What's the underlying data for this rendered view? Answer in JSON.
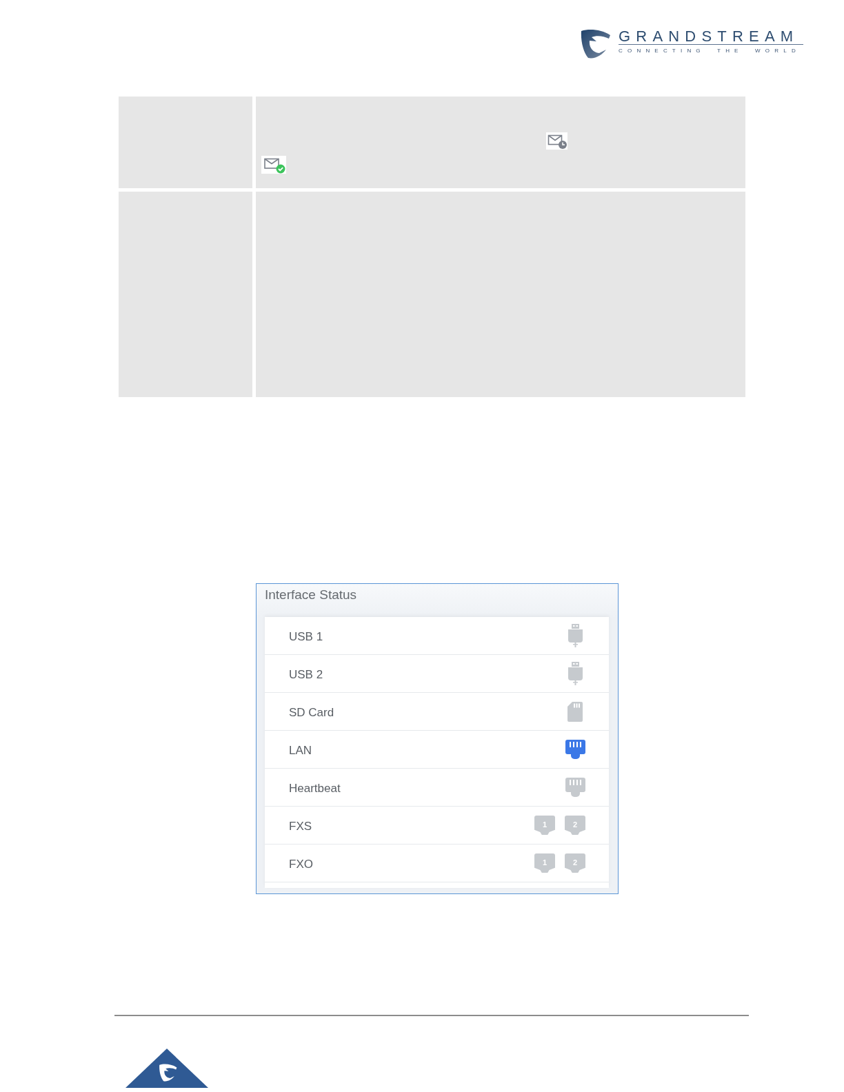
{
  "header": {
    "logo": {
      "wordmark": "GRANDSTREAM",
      "tagline": "CONNECTING THE WORLD"
    }
  },
  "table": {
    "rows": [
      {
        "status_icons": [
          {
            "kind": "pending"
          },
          {
            "kind": "sent"
          }
        ]
      },
      {}
    ]
  },
  "interface_status": {
    "title": "Interface Status",
    "interfaces": [
      {
        "label": "USB 1",
        "kind": "usb",
        "connected": false
      },
      {
        "label": "USB 2",
        "kind": "usb",
        "connected": false
      },
      {
        "label": "SD Card",
        "kind": "sd",
        "connected": false
      },
      {
        "label": "LAN",
        "kind": "ethernet",
        "connected": true
      },
      {
        "label": "Heartbeat",
        "kind": "ethernet",
        "connected": false
      },
      {
        "label": "FXS",
        "kind": "ports",
        "ports": [
          {
            "label": "1",
            "connected": false
          },
          {
            "label": "2",
            "connected": false
          }
        ]
      },
      {
        "label": "FXO",
        "kind": "ports",
        "ports": [
          {
            "label": "1",
            "connected": false
          },
          {
            "label": "2",
            "connected": false
          }
        ]
      }
    ]
  }
}
